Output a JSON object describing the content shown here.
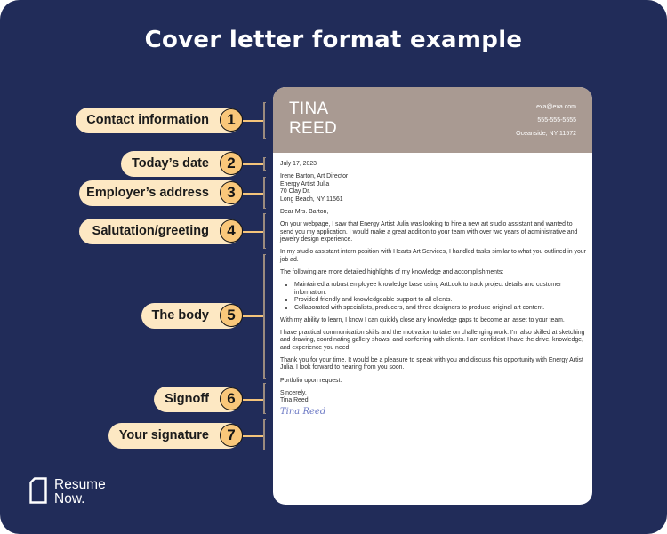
{
  "title": "Cover letter format example",
  "colors": {
    "background": "#212c59",
    "pill": "#fde8c3",
    "badge": "#f9c77a",
    "header": "#a99a92"
  },
  "labels": [
    {
      "num": "1",
      "text": "Contact information"
    },
    {
      "num": "2",
      "text": "Today’s date"
    },
    {
      "num": "3",
      "text": "Employer’s address"
    },
    {
      "num": "4",
      "text": "Salutation/greeting"
    },
    {
      "num": "5",
      "text": "The body"
    },
    {
      "num": "6",
      "text": "Signoff"
    },
    {
      "num": "7",
      "text": "Your signature"
    }
  ],
  "letter": {
    "first_name": "TINA",
    "last_name": "REED",
    "email": "exa@exa.com",
    "phone": "555-555-5555",
    "location": "Oceanside, NY 11572",
    "date": "July 17, 2023",
    "employer": [
      "Irene Barton, Art Director",
      "Energy Artist Julia",
      "70 Clay Dr.",
      "Long Beach, NY 11561"
    ],
    "salutation": "Dear Mrs. Barton,",
    "body_1": "On your webpage, I saw that Energy Artist Julia was looking to hire a new art studio assistant and wanted to send you my application. I would make a great addition to your team with over two years of administrative and jewelry design experience.",
    "body_2": "In my studio assistant intern position with Hearts Art Services, I handled tasks similar to what you outlined in your job ad.",
    "body_3": "The following are more detailed highlights of my knowledge and accomplishments:",
    "bullets": [
      "Maintained a robust employee knowledge base using ArtLook to track project details and customer information.",
      "Provided friendly and knowledgeable support to all clients.",
      "Collaborated with specialists, producers, and three designers to produce original art content."
    ],
    "body_4": "With my ability to learn, I know I can quickly close any knowledge gaps to become an asset to your team.",
    "body_5": "I have practical communication skills and the motivation to take on challenging work. I’m also skilled at sketching and drawing, coordinating gallery shows, and conferring with clients. I am confident I have the drive, knowledge, and experience you need.",
    "signoff_1": "Thank you for your time. It would be a pleasure to speak with you and discuss this opportunity with Energy Artist Julia. I look forward to hearing from you soon.",
    "signoff_2": "Portfolio upon request.",
    "closing": "Sincerely,",
    "closing_name": "Tina Reed",
    "signature": "Tina Reed"
  },
  "logo": {
    "line1": "Resume",
    "line2": "Now."
  }
}
